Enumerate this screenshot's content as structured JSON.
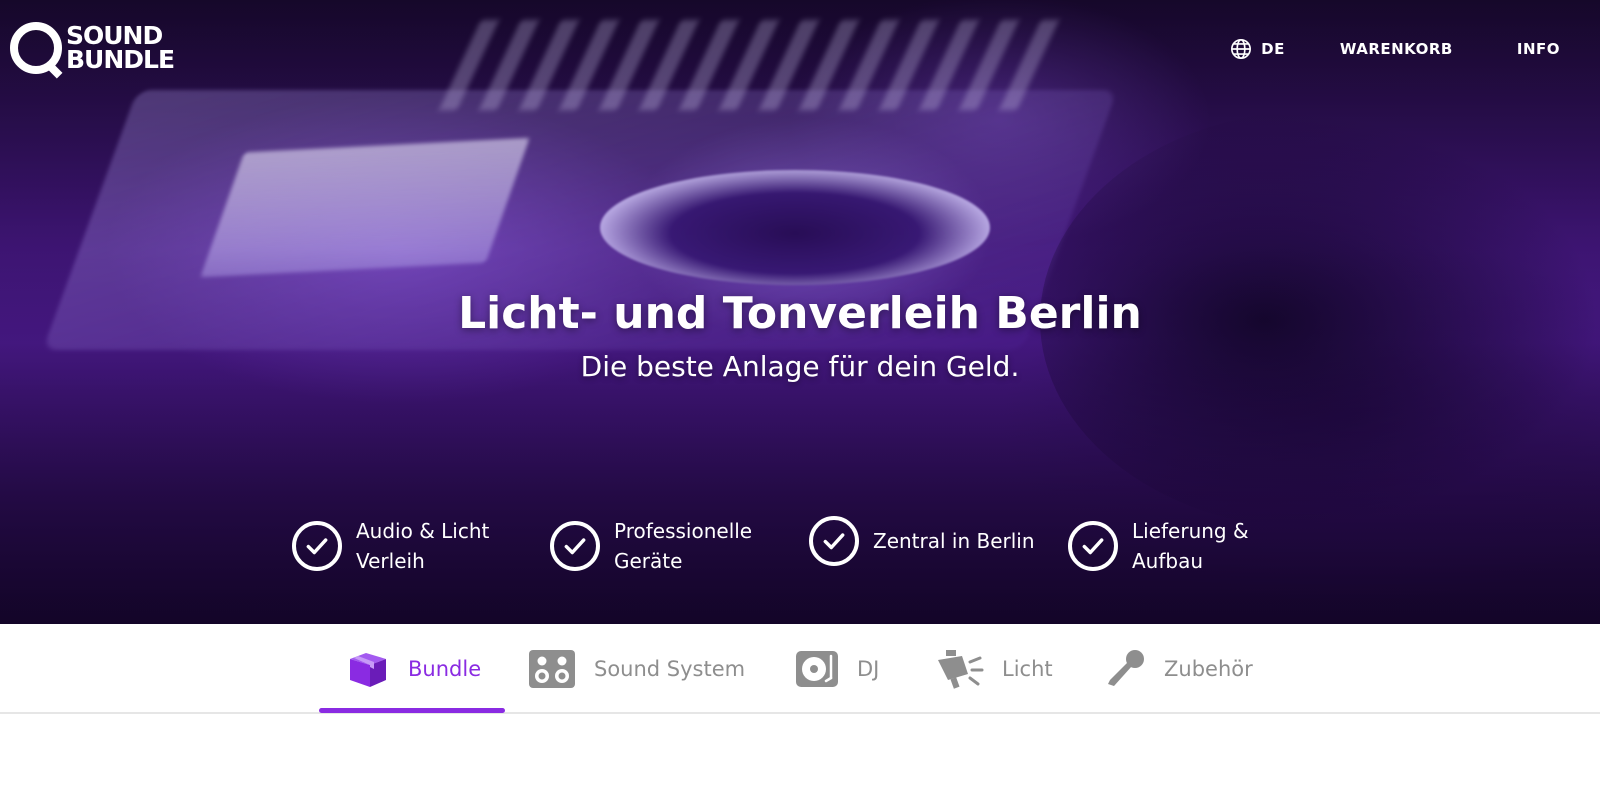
{
  "brand": {
    "line1": "SOUND",
    "line2": "BUNDLE"
  },
  "nav": {
    "language": "DE",
    "cart": "WARENKORB",
    "info": "INFO"
  },
  "hero": {
    "title": "Licht- und Tonverleih Berlin",
    "subtitle": "Die beste Anlage für dein Geld.",
    "features": [
      {
        "label": "Audio & Licht Verleih",
        "icon": "check-circle-icon"
      },
      {
        "label": "Professionelle Geräte",
        "icon": "check-circle-icon"
      },
      {
        "label": "Zentral in Berlin",
        "icon": "check-circle-icon"
      },
      {
        "label": "Lieferung & Aufbau",
        "icon": "check-circle-icon"
      }
    ]
  },
  "categories": {
    "active": "Bundle",
    "tabs": [
      {
        "label": "Bundle",
        "icon": "box-icon"
      },
      {
        "label": "Sound System",
        "icon": "speaker-icon"
      },
      {
        "label": "DJ",
        "icon": "turntable-icon"
      },
      {
        "label": "Licht",
        "icon": "spotlight-icon"
      },
      {
        "label": "Zubehör",
        "icon": "microphone-icon"
      }
    ]
  },
  "colors": {
    "accent": "#8a2be2",
    "tab_inactive": "#8e8e8e",
    "hero_text": "#ffffff"
  }
}
